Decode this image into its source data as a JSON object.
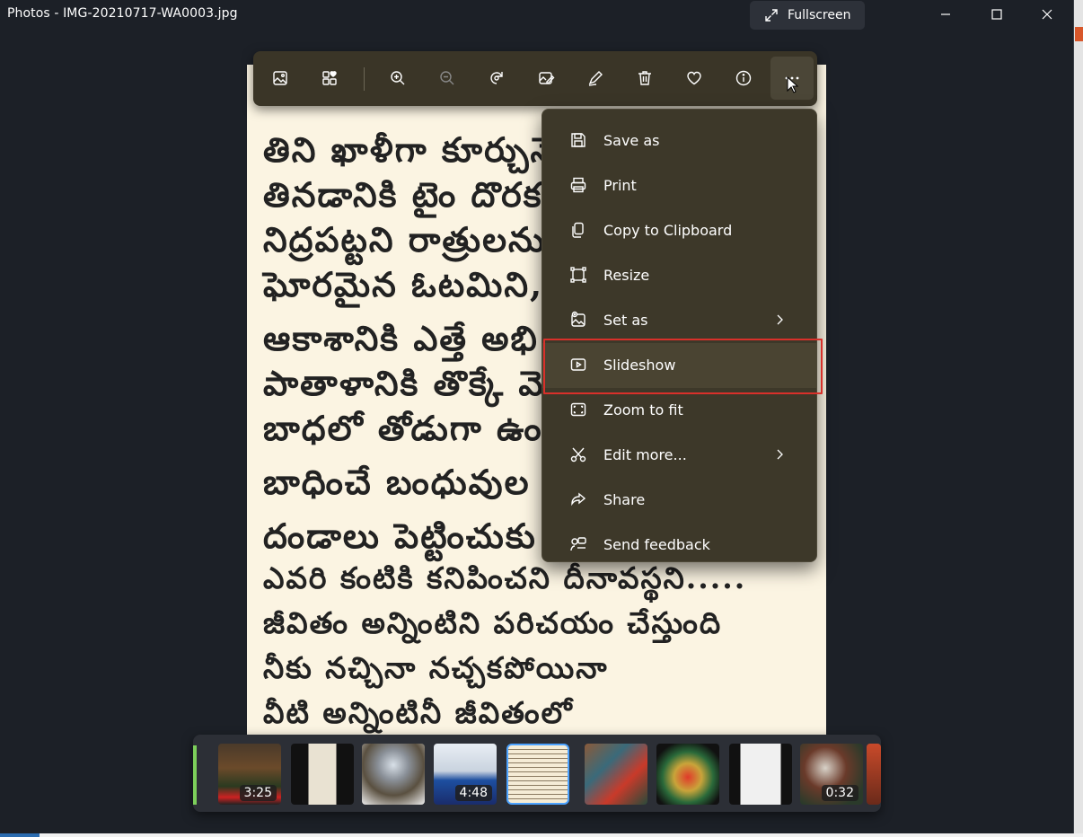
{
  "window": {
    "title": "Photos - IMG-20210717-WA0003.jpg",
    "fullscreen_label": "Fullscreen"
  },
  "image": {
    "lines": [
      "తిని ఖాళీగా కూర్చునే",
      "తినడానికి టైం దొరక",
      "నిద్రపట్టని రాత్రులను",
      "ఘోరమైన ఓటమిని,",
      "ఆకాశానికి ఎత్తే అభి",
      "పాతాళానికి తొక్కే మో",
      "బాధలో తోడుగా ఉం",
      "బాధించే బంధువుల",
      "దండాలు పెట్టించుకు",
      "ఎవరి కంటికి కనిపించని దీనావస్థని.....",
      "జీవితం అన్నింటిని పరిచయం చేస్తుంది",
      "నీకు నచ్చినా నచ్చకపోయినా",
      "వీటి అన్నింటినీ జీవితంలో"
    ]
  },
  "toolbar": {
    "buttons": [
      {
        "icon": "gallery-icon"
      },
      {
        "icon": "add-to-album-icon"
      },
      {
        "icon": "zoom-in-icon"
      },
      {
        "icon": "zoom-out-icon"
      },
      {
        "icon": "rotate-icon"
      },
      {
        "icon": "edit-image-icon"
      },
      {
        "icon": "draw-icon"
      },
      {
        "icon": "delete-icon"
      },
      {
        "icon": "favorite-icon"
      },
      {
        "icon": "info-icon"
      },
      {
        "icon": "more-icon"
      }
    ]
  },
  "menu": {
    "items": [
      {
        "label": "Save as",
        "icon": "save-icon"
      },
      {
        "label": "Print",
        "icon": "print-icon"
      },
      {
        "label": "Copy to Clipboard",
        "icon": "copy-icon"
      },
      {
        "label": "Resize",
        "icon": "resize-icon"
      },
      {
        "label": "Set as",
        "icon": "set-as-icon",
        "submenu": true
      },
      {
        "label": "Slideshow",
        "icon": "slideshow-icon",
        "highlighted": true
      },
      {
        "label": "Zoom to fit",
        "icon": "zoom-to-fit-icon"
      },
      {
        "label": "Edit more...",
        "icon": "edit-more-icon",
        "submenu": true
      },
      {
        "label": "Share",
        "icon": "share-icon"
      },
      {
        "label": "Send feedback",
        "icon": "feedback-icon"
      }
    ]
  },
  "filmstrip": {
    "thumbs": [
      {
        "duration": "3:25"
      },
      {
        "duration": ""
      },
      {
        "duration": ""
      },
      {
        "duration": "4:48"
      },
      {
        "duration": "",
        "selected": true
      },
      {
        "duration": ""
      },
      {
        "duration": ""
      },
      {
        "duration": ""
      },
      {
        "duration": "0:32"
      }
    ]
  },
  "colors": {
    "highlight_border": "#d9302a",
    "selected_thumb": "#4da3ff",
    "toolbar_bg": "#3a3527"
  }
}
